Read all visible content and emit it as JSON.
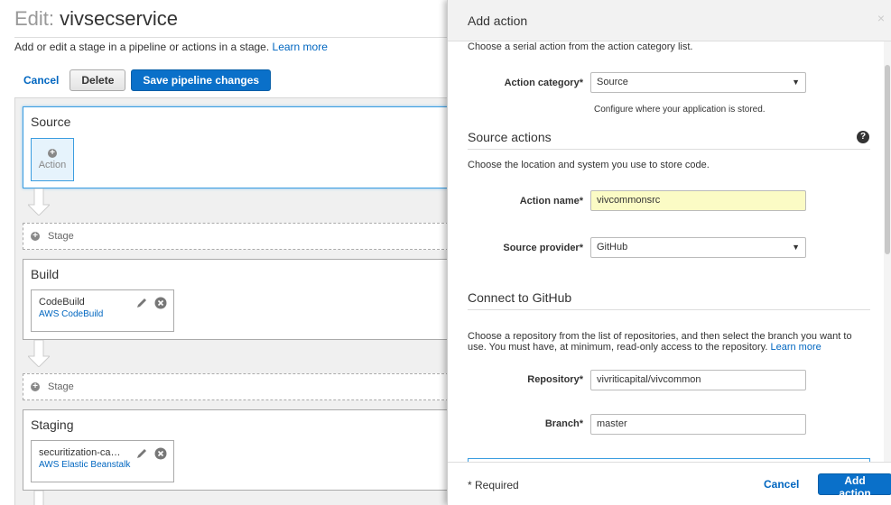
{
  "page": {
    "title_prefix": "Edit:",
    "title_name": "vivsecservice",
    "subtitle": "Add or edit a stage in a pipeline or actions in a stage.",
    "learn_more": "Learn more"
  },
  "toolbar": {
    "cancel": "Cancel",
    "delete": "Delete",
    "save": "Save pipeline changes"
  },
  "pipeline": {
    "add_action_label": "Action",
    "add_stage_label": "Stage",
    "stages": [
      {
        "name": "Source",
        "actions": []
      },
      {
        "name": "Build",
        "actions": [
          {
            "name": "CodeBuild",
            "provider": "AWS CodeBuild"
          }
        ]
      },
      {
        "name": "Staging",
        "actions": [
          {
            "name": "securitization-ca…",
            "provider": "AWS Elastic Beanstalk"
          }
        ]
      }
    ]
  },
  "panel": {
    "title": "Add action",
    "close": "×",
    "intro": "Choose a serial action from the action category list.",
    "action_category": {
      "label": "Action category*",
      "value": "Source",
      "hint": "Configure where your application is stored."
    },
    "source_actions": {
      "title": "Source actions",
      "help": "?",
      "desc": "Choose the location and system you use to store code.",
      "action_name": {
        "label": "Action name*",
        "value": "vivcommonsrc"
      },
      "source_provider": {
        "label": "Source provider*",
        "value": "GitHub"
      }
    },
    "github": {
      "title": "Connect to GitHub",
      "desc_line1": "Choose a repository from the list of repositories, and then select the branch you want to",
      "desc_line2": "use. You must have, at minimum, read-only access to the repository.",
      "learn_more": "Learn more",
      "repository": {
        "label": "Repository*",
        "value": "vivriticapital/vivcommon"
      },
      "branch": {
        "label": "Branch*",
        "value": "master"
      }
    },
    "footer": {
      "required": "* Required",
      "cancel": "Cancel",
      "add": "Add action"
    }
  }
}
